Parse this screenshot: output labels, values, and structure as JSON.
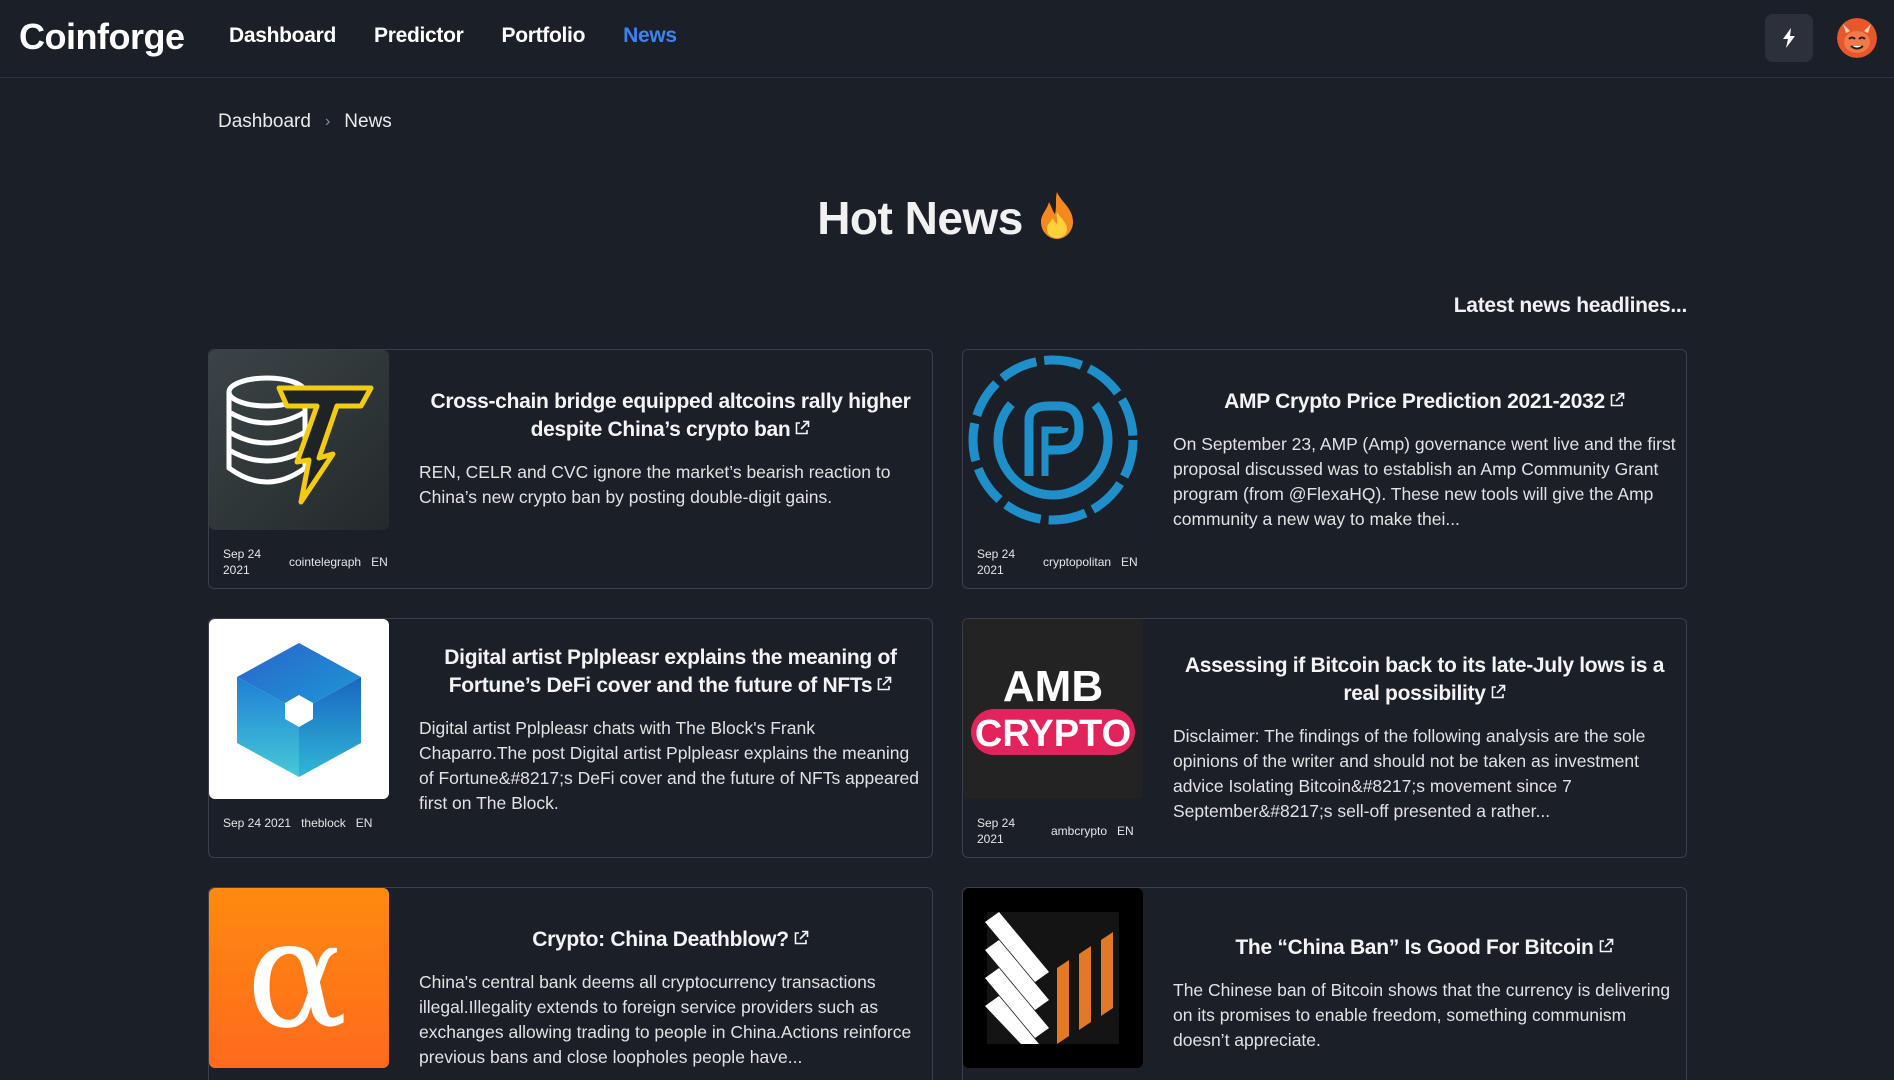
{
  "app": {
    "logo": "Coinforge"
  },
  "nav": {
    "items": [
      {
        "label": "Dashboard",
        "active": false
      },
      {
        "label": "Predictor",
        "active": false
      },
      {
        "label": "Portfolio",
        "active": false
      },
      {
        "label": "News",
        "active": true
      }
    ],
    "icons": [
      "bolt-icon",
      "avatar-devil-icon"
    ]
  },
  "breadcrumb": {
    "items": [
      "Dashboard",
      "News"
    ]
  },
  "page": {
    "title": "Hot News",
    "title_icon": "fire-icon",
    "subtitle": "Latest news headlines..."
  },
  "colors": {
    "accent": "#3d82f5",
    "background": "#1b1f28",
    "card_border": "#3a3f4a"
  },
  "articles": [
    {
      "title": "Cross-chain bridge equipped altcoins rally higher despite China’s crypto ban",
      "description": "REN, CELR and CVC ignore the market’s bearish reaction to China’s new crypto ban by posting double-digit gains.",
      "date_line1": "Sep 24",
      "date_line2": "2021",
      "source": "cointelegraph",
      "lang": "EN",
      "icon": "coin-lightning-icon"
    },
    {
      "title": "AMP Crypto Price Prediction 2021-2032",
      "description": "On September 23, AMP (Amp) governance went live and the first proposal discussed was to establish an Amp Community Grant program (from @FlexaHQ). These new tools will give the Amp community a new way to make thei...",
      "date_line1": "Sep 24",
      "date_line2": "2021",
      "source": "cryptopolitan",
      "lang": "EN",
      "icon": "cryptopolitan-logo-icon"
    },
    {
      "title": "Digital artist Pplpleasr explains the meaning of Fortune’s DeFi cover and the future of NFTs",
      "description": "Digital artist Pplpleasr chats with The Block's Frank Chaparro.The post Digital artist Pplpleasr explains the meaning of Fortune&#8217;s DeFi cover and the future of NFTs appeared first on The Block.",
      "date_line1": "Sep 24 2021",
      "date_line2": "",
      "source": "theblock",
      "lang": "EN",
      "icon": "theblock-cube-icon"
    },
    {
      "title": "Assessing if Bitcoin back to its late-July lows is a real possibility",
      "description": "Disclaimer: The findings of the following analysis are the sole opinions of the writer and should not be taken as investment advice Isolating Bitcoin&#8217;s movement since 7 September&#8217;s sell-off presented a rather...",
      "date_line1": "Sep 24",
      "date_line2": "2021",
      "source": "ambcrypto",
      "lang": "EN",
      "icon": "ambcrypto-logo-icon",
      "logo_line1": "AMB",
      "logo_line2": "CRYPTO"
    },
    {
      "title": "Crypto: China Deathblow?",
      "description": "China's central bank deems all cryptocurrency transactions illegal.Illegality extends to foreign service providers such as exchanges allowing trading to people in China.Actions reinforce previous bans and close loopholes people have...",
      "date_line1": "",
      "date_line2": "",
      "source": "",
      "lang": "",
      "icon": "alpha-icon"
    },
    {
      "title": "The “China Ban” Is Good For Bitcoin",
      "description": "The Chinese ban of Bitcoin shows that the currency is delivering on its promises to enable freedom, something communism doesn’t appreciate.",
      "date_line1": "",
      "date_line2": "",
      "source": "",
      "lang": "",
      "icon": "bitcoin-magazine-icon"
    }
  ]
}
